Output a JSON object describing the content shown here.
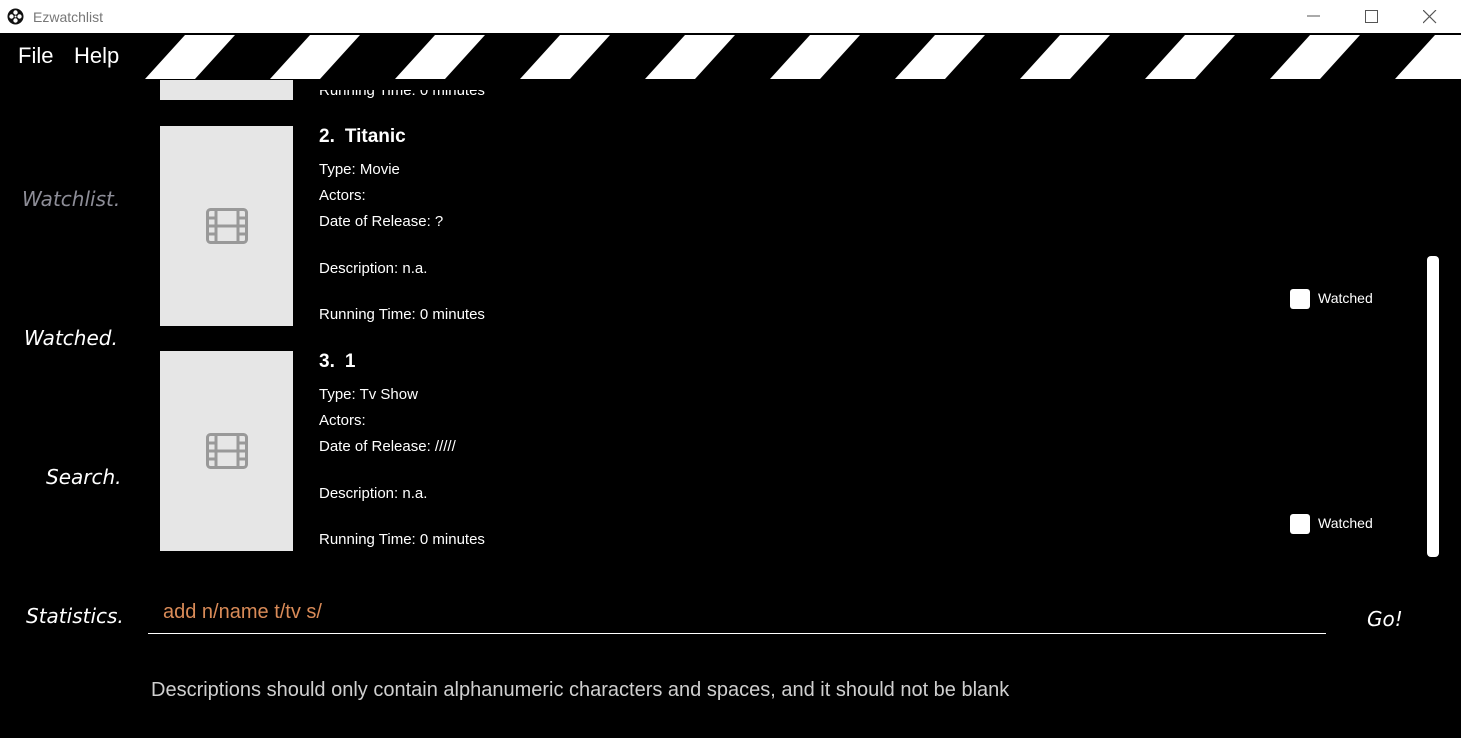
{
  "window": {
    "title": "Ezwatchlist",
    "icons": [
      "film-reel-icon",
      "minimize-icon",
      "maximize-icon",
      "close-icon"
    ]
  },
  "menu": {
    "file": "File",
    "help": "Help"
  },
  "sidebar": {
    "items": [
      {
        "label": "Watchlist.",
        "active": true
      },
      {
        "label": "Watched."
      },
      {
        "label": "Search."
      },
      {
        "label": "Statistics."
      }
    ]
  },
  "list": {
    "partial_item": {
      "running_time": "Running Time: 0 minutes"
    },
    "items": [
      {
        "index": "2.",
        "title": "Titanic",
        "type": "Type: Movie",
        "actors": "Actors:",
        "date": "Date of Release: ?",
        "description": "Description: n.a.",
        "running_time": "Running Time: 0 minutes",
        "watched_label": "Watched",
        "watched": false
      },
      {
        "index": "3.",
        "title": "1",
        "type": "Type: Tv Show",
        "actors": "Actors:",
        "date": "Date of Release: /////",
        "description": "Description: n.a.",
        "running_time": "Running Time: 0 minutes",
        "watched_label": "Watched",
        "watched": false
      }
    ]
  },
  "command": {
    "placeholder": "add n/name t/tv s/",
    "go_label": "Go!"
  },
  "result_message": "Descriptions should only contain alphanumeric characters and spaces, and it should not be blank",
  "colors": {
    "background": "#000000",
    "command_text": "#d98b58",
    "active_nav": "#8d8d97"
  }
}
